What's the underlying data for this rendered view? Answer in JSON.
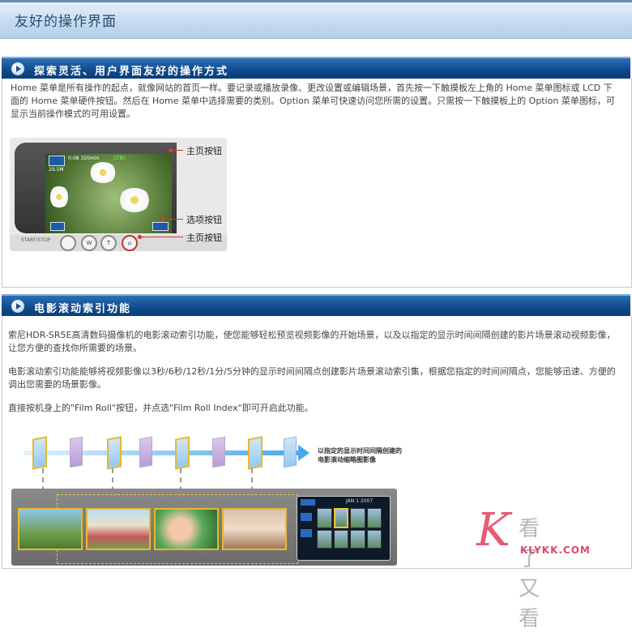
{
  "banner": {
    "title": "友好的操作界面"
  },
  "section1": {
    "heading": "探索灵活、用户界面友好的操作方式",
    "paragraph": "Home 菜单是所有操作的起点，就像网站的首页一样。要记录或播放录像、更改设置或编辑场景，首先按一下触摸板左上角的 Home 菜单图标或 LCD 下面的 Home 菜单硬件按钮。然后在 Home 菜单中选择需要的类别。Option 菜单可快速访问您所需的设置。只需按一下触摸板上的 Option 菜单图标，可显示当前操作模式的可用设置。",
    "callouts": [
      "主页按钮",
      "选项按钮",
      "主页按钮"
    ],
    "camera": {
      "start_label": "START/STOP",
      "btn_w": "W",
      "btn_t": "T",
      "screen_text": "0:08 320min",
      "screen_text2": "STBY",
      "screen_text3": "29.5M"
    }
  },
  "section2": {
    "heading": "电影滚动索引功能",
    "paragraphs": [
      "索尼HDR-SR5E高清数码摄像机的电影滚动索引功能，使您能够轻松预览视频影像的开始场景，以及以指定的显示时间间隔创建的影片场景滚动视频影像，让您方便的查找你所需要的场景。",
      "电影滚动索引功能能够将视频影像以3秒/6秒/12秒/1分/5分钟的显示时间间隔点创建影片场景滚动索引集，根据您指定的时间间隔点，您能够迅速、方便的调出您需要的场景影像。",
      "直接按机身上的\"Film Roll\"按钮，并点选\"Film Roll Index\"即可开启此功能。"
    ],
    "diagram_annotation": [
      "以指定的显示时间间隔创建的",
      "电影滚动缩略图影像"
    ],
    "screen_date": "JAN 1 2007"
  },
  "watermark": {
    "letter": "K",
    "chinese": "看了又看",
    "url": "KLYKK.COM"
  },
  "colors": {
    "section_header": "#0f4a8c",
    "callout_red": "#e0382f",
    "accent_gold": "#e6b92e",
    "arrow_blue": "#4aa8ea"
  }
}
